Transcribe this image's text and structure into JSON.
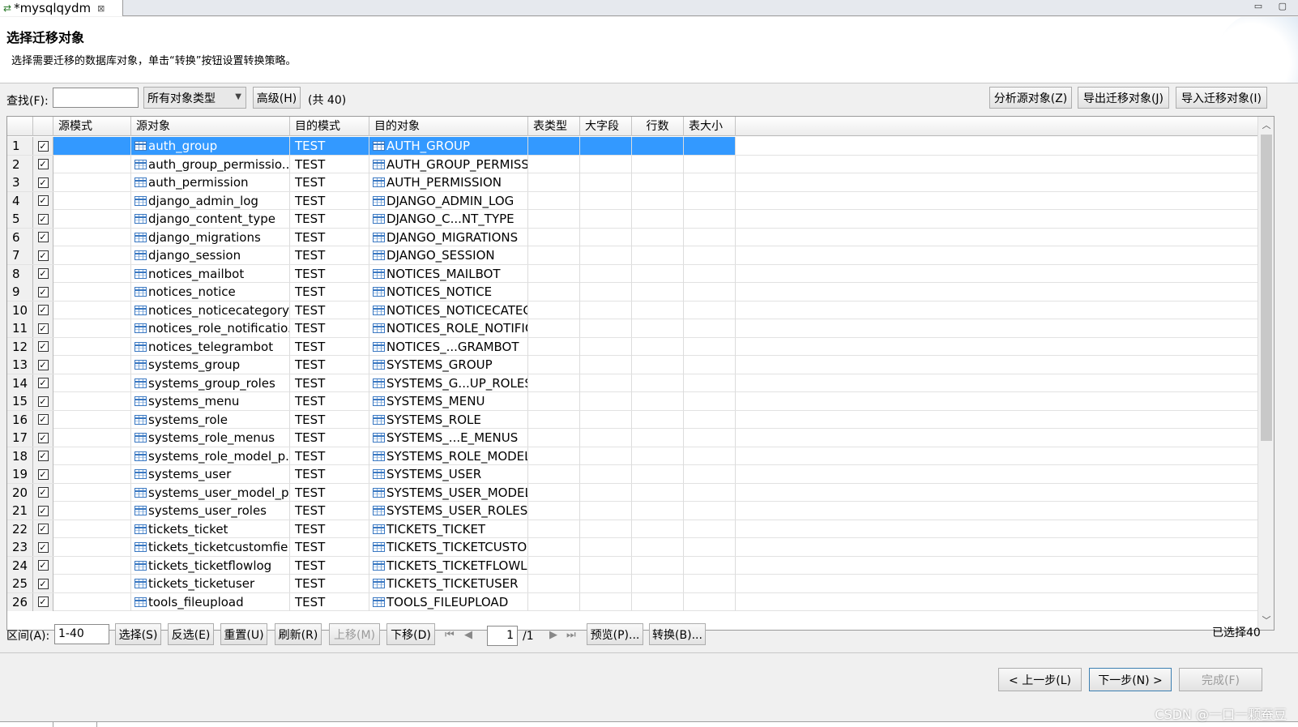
{
  "tab": {
    "title": "*mysqlqydm",
    "close": "⊠"
  },
  "window_controls": "▭ ▢",
  "header": {
    "title": "选择迁移对象",
    "description": "选择需要迁移的数据库对象，单击“转换”按钮设置转换策略。"
  },
  "search": {
    "find_label": "查找(F):",
    "find_value": "",
    "type_select": "所有对象类型",
    "advanced_button": "高级(H)",
    "count_text": "(共 40)",
    "analyze_button": "分析源对象(Z)",
    "export_button": "导出迁移对象(J)",
    "import_button": "导入迁移对象(I)"
  },
  "table": {
    "columns": [
      "",
      "",
      "源模式",
      "源对象",
      "目的模式",
      "目的对象",
      "表类型",
      "大字段",
      "行数",
      "表大小"
    ],
    "rows": [
      {
        "n": "1",
        "src": "auth_group",
        "dschema": "TEST",
        "dst": "AUTH_GROUP",
        "selected": true
      },
      {
        "n": "2",
        "src": "auth_group_permissio...",
        "dschema": "TEST",
        "dst": "AUTH_GROUP_PERMISSI"
      },
      {
        "n": "3",
        "src": "auth_permission",
        "dschema": "TEST",
        "dst": "AUTH_PERMISSION"
      },
      {
        "n": "4",
        "src": "django_admin_log",
        "dschema": "TEST",
        "dst": "DJANGO_ADMIN_LOG"
      },
      {
        "n": "5",
        "src": "django_content_type",
        "dschema": "TEST",
        "dst": "DJANGO_C...NT_TYPE"
      },
      {
        "n": "6",
        "src": "django_migrations",
        "dschema": "TEST",
        "dst": "DJANGO_MIGRATIONS"
      },
      {
        "n": "7",
        "src": "django_session",
        "dschema": "TEST",
        "dst": "DJANGO_SESSION"
      },
      {
        "n": "8",
        "src": "notices_mailbot",
        "dschema": "TEST",
        "dst": "NOTICES_MAILBOT"
      },
      {
        "n": "9",
        "src": "notices_notice",
        "dschema": "TEST",
        "dst": "NOTICES_NOTICE"
      },
      {
        "n": "10",
        "src": "notices_noticecategory",
        "dschema": "TEST",
        "dst": "NOTICES_NOTICECATEG"
      },
      {
        "n": "11",
        "src": "notices_role_notificatio...",
        "dschema": "TEST",
        "dst": "NOTICES_ROLE_NOTIFIC"
      },
      {
        "n": "12",
        "src": "notices_telegrambot",
        "dschema": "TEST",
        "dst": "NOTICES_...GRAMBOT"
      },
      {
        "n": "13",
        "src": "systems_group",
        "dschema": "TEST",
        "dst": "SYSTEMS_GROUP"
      },
      {
        "n": "14",
        "src": "systems_group_roles",
        "dschema": "TEST",
        "dst": "SYSTEMS_G...UP_ROLES"
      },
      {
        "n": "15",
        "src": "systems_menu",
        "dschema": "TEST",
        "dst": "SYSTEMS_MENU"
      },
      {
        "n": "16",
        "src": "systems_role",
        "dschema": "TEST",
        "dst": "SYSTEMS_ROLE"
      },
      {
        "n": "17",
        "src": "systems_role_menus",
        "dschema": "TEST",
        "dst": "SYSTEMS_...E_MENUS"
      },
      {
        "n": "18",
        "src": "systems_role_model_p...",
        "dschema": "TEST",
        "dst": "SYSTEMS_ROLE_MODEL_"
      },
      {
        "n": "19",
        "src": "systems_user",
        "dschema": "TEST",
        "dst": "SYSTEMS_USER"
      },
      {
        "n": "20",
        "src": "systems_user_model_p...",
        "dschema": "TEST",
        "dst": "SYSTEMS_USER_MODEL_"
      },
      {
        "n": "21",
        "src": "systems_user_roles",
        "dschema": "TEST",
        "dst": "SYSTEMS_USER_ROLES"
      },
      {
        "n": "22",
        "src": "tickets_ticket",
        "dschema": "TEST",
        "dst": "TICKETS_TICKET"
      },
      {
        "n": "23",
        "src": "tickets_ticketcustomfie...",
        "dschema": "TEST",
        "dst": "TICKETS_TICKETCUSTON"
      },
      {
        "n": "24",
        "src": "tickets_ticketflowlog",
        "dschema": "TEST",
        "dst": "TICKETS_TICKETFLOWLC"
      },
      {
        "n": "25",
        "src": "tickets_ticketuser",
        "dschema": "TEST",
        "dst": "TICKETS_TICKETUSER"
      },
      {
        "n": "26",
        "src": "tools_fileupload",
        "dschema": "TEST",
        "dst": "TOOLS_FILEUPLOAD"
      }
    ]
  },
  "range": {
    "label": "区间(A):",
    "value": "1-40",
    "select_button": "选择(S)",
    "invert_button": "反选(E)",
    "reset_button": "重置(U)",
    "refresh_button": "刷新(R)",
    "up_button": "上移(M)",
    "down_button": "下移(D)",
    "page_value": "1",
    "page_total": "/1",
    "preview_button": "预览(P)...",
    "convert_button": "转换(B)...",
    "selected_text": "已选择40"
  },
  "footer": {
    "prev_button": "< 上一步(L)",
    "next_button": "下一步(N) >",
    "finish_button": "完成(F)"
  },
  "watermark": "CSDN @一口一颗蚕豆",
  "colors": {
    "selection": "#3399ff",
    "icon": "#3a78c2"
  }
}
